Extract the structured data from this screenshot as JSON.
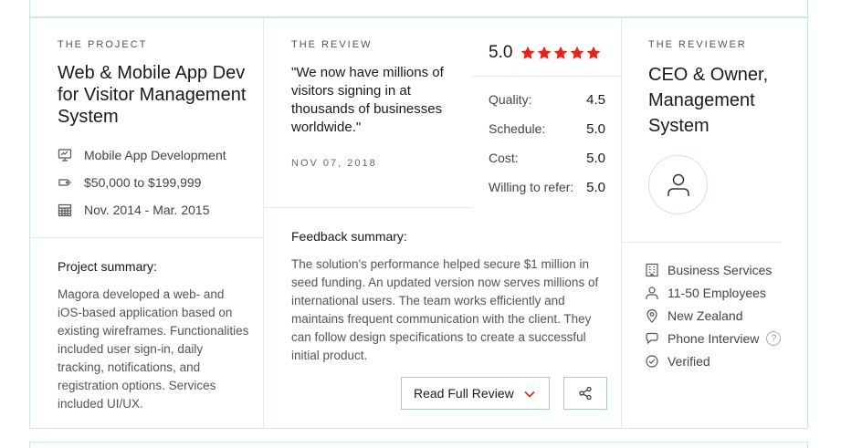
{
  "project": {
    "eyebrow": "THE PROJECT",
    "title": "Web & Mobile App Dev for Visitor Management System",
    "meta": [
      {
        "icon": "monitor-icon",
        "label": "Mobile App Development"
      },
      {
        "icon": "price-tag-icon",
        "label": "$50,000 to $199,999"
      },
      {
        "icon": "calendar-icon",
        "label": "Nov. 2014 - Mar. 2015"
      }
    ],
    "summary_heading": "Project summary:",
    "summary_text": "Magora developed a web- and iOS-based application based on existing wireframes. Functionalities included user sign-in, daily tracking, notifications, and registration options. Services included UI/UX."
  },
  "review": {
    "eyebrow": "THE REVIEW",
    "quote": "\"We now have millions of visitors signing in at thousands of businesses worldwide.\"",
    "date": "NOV 07, 2018",
    "overall_rating": "5.0",
    "stars": 5,
    "scores": [
      {
        "label": "Quality:",
        "value": "4.5"
      },
      {
        "label": "Schedule:",
        "value": "5.0"
      },
      {
        "label": "Cost:",
        "value": "5.0"
      },
      {
        "label": "Willing to refer:",
        "value": "5.0"
      }
    ],
    "feedback_heading": "Feedback summary:",
    "feedback_text": "The solution's performance helped secure $1 million in seed funding. An updated version now serves millions of international users. The team works efficiently and maintains frequent communication with the client. They can follow design specifications to create a successful initial product.",
    "read_full_label": "Read Full Review",
    "share_icon": "share-icon"
  },
  "reviewer": {
    "eyebrow": "THE REVIEWER",
    "title": "CEO & Owner, Management System",
    "info": [
      {
        "icon": "building-icon",
        "label": "Business Services"
      },
      {
        "icon": "person-icon",
        "label": "11-50 Employees"
      },
      {
        "icon": "location-pin-icon",
        "label": "New Zealand"
      },
      {
        "icon": "chat-bubble-icon",
        "label": "Phone Interview"
      },
      {
        "icon": "check-circle-icon",
        "label": "Verified"
      }
    ],
    "help_glyph": "?"
  },
  "colors": {
    "star": "#e62415",
    "chevron": "#e62415",
    "border": "#cfe3ea",
    "button_border": "#a9c9d6"
  }
}
